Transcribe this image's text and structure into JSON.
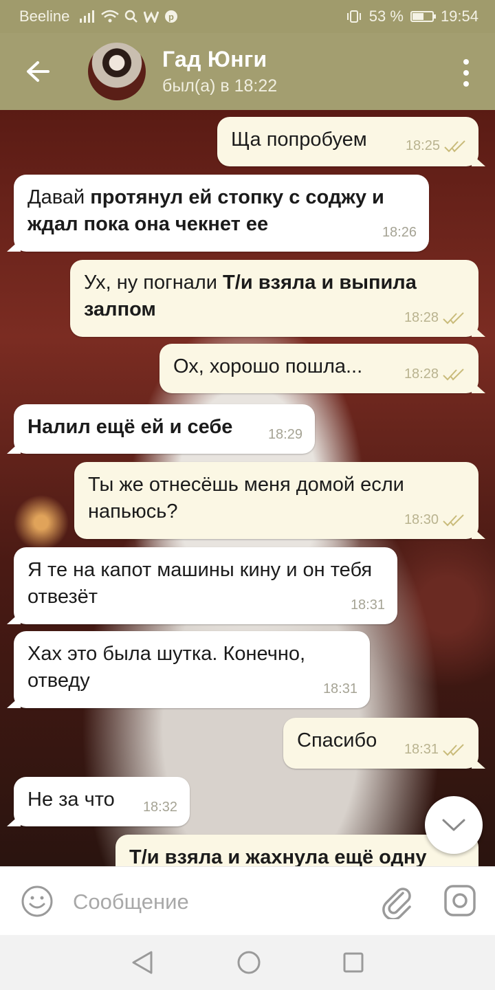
{
  "status_bar": {
    "carrier": "Beeline",
    "battery_percent": "53 %",
    "battery_level": 0.53,
    "time": "19:54"
  },
  "header": {
    "contact_name": "Гад Юнги",
    "last_seen": "был(а) в 18:22"
  },
  "messages": [
    {
      "direction": "out",
      "text": "Ща попробуем",
      "time": "18:25",
      "read": true
    },
    {
      "direction": "in",
      "plain": "Давай ",
      "bold": "протянул ей стопку с соджу и ждал пока она чекнет ее",
      "time": "18:26"
    },
    {
      "direction": "out",
      "plain": "Ух, ну погнали ",
      "bold": "Т/и взяла и выпила залпом",
      "time": "18:28",
      "read": true
    },
    {
      "direction": "out",
      "text": "Ох, хорошо пошла...",
      "time": "18:28",
      "read": true
    },
    {
      "direction": "in",
      "bold": "Налил ещё ей и себе",
      "time": "18:29"
    },
    {
      "direction": "out",
      "text": "Ты же отнесёшь меня домой если напьюсь?",
      "time": "18:30",
      "read": true
    },
    {
      "direction": "in",
      "text": "Я те на капот машины кину и он тебя отвезёт",
      "time": "18:31"
    },
    {
      "direction": "in",
      "text": "Хах это была шутка. Конечно, отведу",
      "time": "18:31"
    },
    {
      "direction": "out",
      "text": "Спасибо",
      "time": "18:31",
      "read": true
    },
    {
      "direction": "in",
      "text": "Не за что",
      "time": "18:32"
    },
    {
      "direction": "out",
      "bold": "Т/и взяла и жахнула ещё одну",
      "time": ""
    }
  ],
  "composer": {
    "placeholder": "Сообщение"
  },
  "colors": {
    "header": "#a39e70",
    "status_bar": "#a09b6c",
    "outgoing_bubble": "#fbf7e4",
    "incoming_bubble": "#ffffff",
    "read_ticks": "#c9bb7a"
  }
}
